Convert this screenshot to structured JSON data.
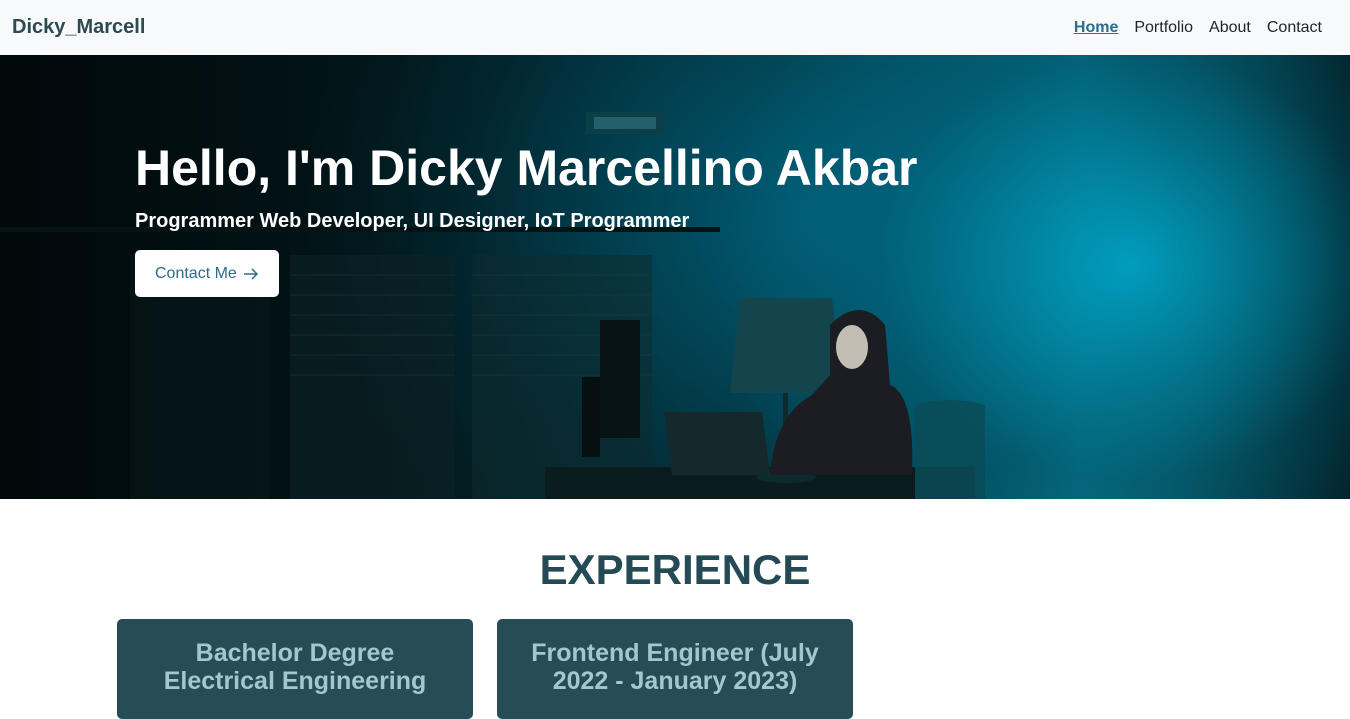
{
  "navbar": {
    "brand": "Dicky_Marcell",
    "links": [
      {
        "label": "Home",
        "active": true
      },
      {
        "label": "Portfolio",
        "active": false
      },
      {
        "label": "About",
        "active": false
      },
      {
        "label": "Contact",
        "active": false
      }
    ]
  },
  "hero": {
    "title": "Hello, I'm Dicky Marcellino Akbar",
    "subtitle": "Programmer Web Developer, UI Designer, IoT Programmer",
    "cta_label": "Contact Me",
    "cta_icon": "arrow-right-icon"
  },
  "experience": {
    "heading": "EXPERIENCE",
    "cards": [
      {
        "title": "Bachelor Degree Electrical Engineering"
      },
      {
        "title": "Frontend Engineer (July 2022 - January 2023)"
      }
    ]
  },
  "colors": {
    "brand": "#2c4a52",
    "accent": "#2b6c8f",
    "card_bg": "#264c56",
    "card_text": "#9fc9cf"
  }
}
